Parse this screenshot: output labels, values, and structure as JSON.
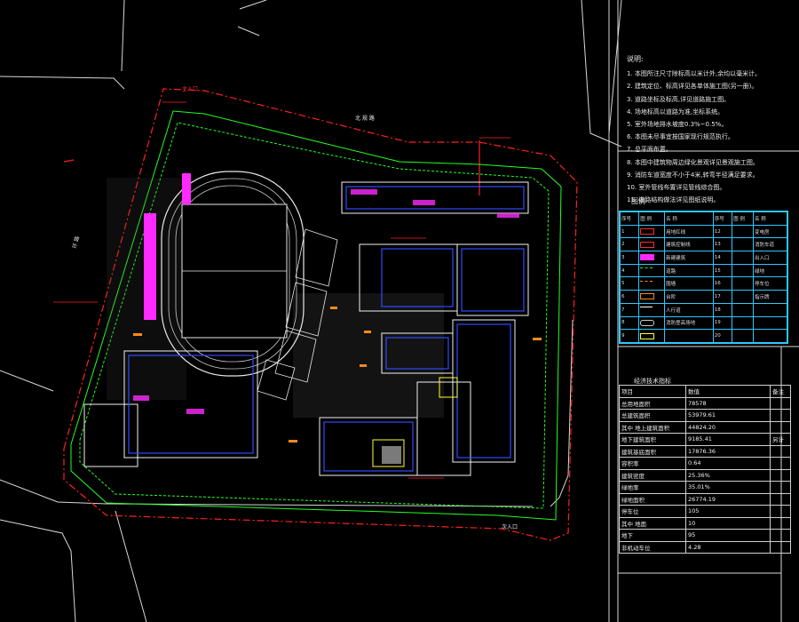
{
  "notes": {
    "title": "说明:",
    "items": [
      "1. 本图所注尺寸除标高以米计外,余均以毫米计。",
      "2. 建筑定位、标高详见各单体施工图(另一册)。",
      "3. 道路坐标及标高,详见道路施工图。",
      "4. 场地标高以道路为准,坐标系统。",
      "5. 室外场地排水坡度0.3%~0.5%。",
      "6. 本图未尽事宜按国家现行规范执行。",
      "7. 总平面布置。",
      "8. 本图中建筑物周边绿化景观详见景观施工图。",
      "9. 消防车道宽度不小于4米,转弯半径满足要求。",
      "10. 室外管线布置详见管线综合图。",
      "11. 道路结构做法详见图纸说明。"
    ]
  },
  "legend": {
    "title": "图例",
    "headers": [
      "序号",
      "图  例",
      "名  称",
      "序号",
      "图  例",
      "名  称"
    ],
    "rows": [
      [
        "1",
        "",
        "用地红线",
        "12",
        "",
        "变电房"
      ],
      [
        "2",
        "",
        "建筑控制线",
        "13",
        "",
        "消防车道"
      ],
      [
        "3",
        "",
        "新建建筑",
        "14",
        "",
        "出入口"
      ],
      [
        "4",
        "",
        "道路",
        "15",
        "",
        "绿地"
      ],
      [
        "5",
        "",
        "围墙",
        "16",
        "",
        "停车位"
      ],
      [
        "6",
        "",
        "台阶",
        "17",
        "",
        "指示牌"
      ],
      [
        "7",
        "",
        "人行道",
        "18",
        "",
        ""
      ],
      [
        "8",
        "",
        "消防登高场地",
        "19",
        "",
        ""
      ],
      [
        "9",
        "",
        "",
        "20",
        "",
        ""
      ]
    ]
  },
  "econ": {
    "title": "经济技术指标",
    "headers": [
      "项目",
      "数值",
      "备注"
    ],
    "rows": [
      [
        "总用地面积",
        "78578",
        ""
      ],
      [
        "总建筑面积",
        "53979.61",
        ""
      ],
      [
        "其中  地上建筑面积",
        "44824.20",
        ""
      ],
      [
        "地下建筑面积",
        "9185.41",
        ""
      ],
      [
        "建筑基底面积",
        "17876.36",
        ""
      ],
      [
        "容积率",
        "0.64",
        ""
      ],
      [
        "建筑密度",
        "25.36%",
        ""
      ],
      [
        "绿地率",
        "35.01%",
        ""
      ],
      [
        "绿地面积",
        "26774.19",
        ""
      ],
      [
        "停车位",
        "105",
        ""
      ],
      [
        "其中  地面",
        "10",
        ""
      ],
      [
        "地下",
        "95",
        ""
      ],
      [
        "非机动车位",
        "4.28",
        ""
      ]
    ],
    "remark": "另计"
  },
  "site_labels": {
    "road_top": "北  规  路",
    "road_left": "环  路",
    "gate_top": "主入口",
    "gate_bottom": "次入口"
  },
  "colors": {
    "redline": "#ff2020",
    "green": "#22ff22",
    "magenta": "#ff2aff",
    "blue": "#2f4bff",
    "white": "#f2f2f2",
    "cyan": "#2ec7ff",
    "yellow": "#ffff33",
    "orange": "#ff8a1f"
  }
}
